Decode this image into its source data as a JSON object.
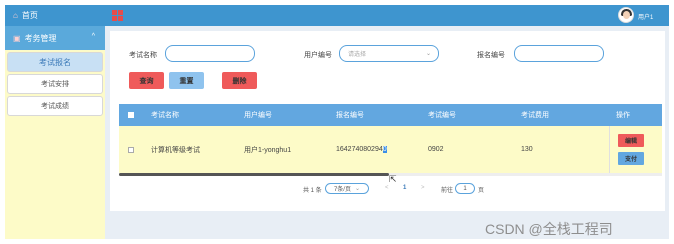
{
  "sidebar": {
    "home_label": "首页",
    "menu_label": "考务管理",
    "menu_chevron": "^",
    "items": [
      {
        "label": "考试报名",
        "active": true
      },
      {
        "label": "考试安排",
        "active": false
      },
      {
        "label": "考试成绩",
        "active": false
      }
    ]
  },
  "header": {
    "user_name": "用户1"
  },
  "search": {
    "exam_name_label": "考试名称",
    "exam_name_value": "",
    "user_no_label": "用户编号",
    "user_no_placeholder": "请选择",
    "enroll_no_label": "报名编号",
    "enroll_no_value": ""
  },
  "actions": {
    "query": "查询",
    "reset": "重置",
    "delete": "删除"
  },
  "table": {
    "headers": [
      "考试名称",
      "用户编号",
      "报名编号",
      "考试编号",
      "考试费用",
      "操作"
    ],
    "rows": [
      {
        "exam_name": "计算机等级考试",
        "user_no": "用户1-yonghu1",
        "enroll_no_part1": "1642740802",
        "enroll_no_part2": "94",
        "enroll_no_selected": "0",
        "exam_no": "0902",
        "fee": "130",
        "edit": "编辑",
        "pay": "支付"
      }
    ]
  },
  "pagination": {
    "total": "共 1 条",
    "page_size": "7条/页",
    "prev": "<",
    "current": "1",
    "next": ">",
    "goto_label": "前往",
    "goto_value": "1",
    "page_suffix": "页"
  },
  "watermark": "CSDN @全栈工程司",
  "colors": {
    "accent": "#3e95cf",
    "danger": "#ef5a5a",
    "sidebar_bg": "#fdfbc8"
  }
}
